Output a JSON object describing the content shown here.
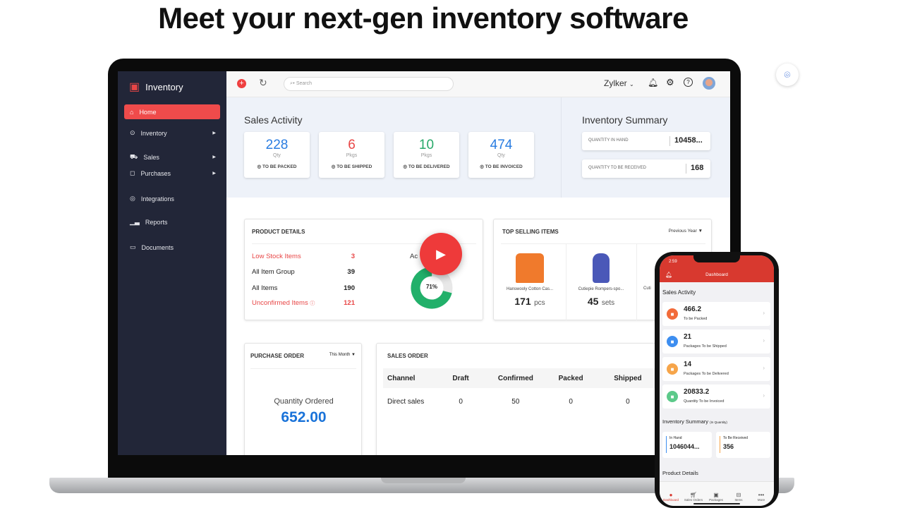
{
  "headline": "Meet your next-gen inventory software",
  "app": {
    "name": "Inventory",
    "sidebar": [
      {
        "label": "Home",
        "icon": "home-icon",
        "active": true
      },
      {
        "label": "Inventory",
        "icon": "inventory-icon",
        "submenu": true
      },
      {
        "label": "Sales",
        "icon": "cart-icon",
        "submenu": true
      },
      {
        "label": "Purchases",
        "icon": "bag-icon",
        "submenu": true
      },
      {
        "label": "Integrations",
        "icon": "integrations-icon"
      },
      {
        "label": "Reports",
        "icon": "reports-icon"
      },
      {
        "label": "Documents",
        "icon": "folder-icon"
      }
    ],
    "topbar": {
      "search_placeholder": "Search",
      "org": "Zylker"
    },
    "sales_activity": {
      "title": "Sales Activity",
      "cards": [
        {
          "value": "228",
          "unit": "Qty",
          "label": "TO BE PACKED",
          "color": "#2a7de1"
        },
        {
          "value": "6",
          "unit": "Pkgs",
          "label": "TO BE SHIPPED",
          "color": "#e84646"
        },
        {
          "value": "10",
          "unit": "Pkgs",
          "label": "TO BE DELIVERED",
          "color": "#28a96a"
        },
        {
          "value": "474",
          "unit": "Qty",
          "label": "TO BE INVOICED",
          "color": "#2a7de1"
        }
      ]
    },
    "inventory_summary": {
      "title": "Inventory Summary",
      "rows": [
        {
          "label": "QUANTITY IN HAND",
          "value": "10458..."
        },
        {
          "label": "QUANTITY TO BE RECEIVED",
          "value": "168"
        }
      ]
    },
    "product_details": {
      "title": "PRODUCT DETAILS",
      "rows": [
        {
          "label": "Low Stock Items",
          "value": "3"
        },
        {
          "label": "All Item Group",
          "value": "39"
        },
        {
          "label": "All Items",
          "value": "190"
        },
        {
          "label": "Unconfirmed Items",
          "value": "121"
        }
      ],
      "chart_label": "Ac",
      "active_percent": "71%",
      "active_fraction": 0.71
    },
    "top_selling": {
      "title": "TOP SELLING ITEMS",
      "period": "Previous Year",
      "items": [
        {
          "name": "Hanswooly Cotton Cas...",
          "qty": "171",
          "unit": "pcs"
        },
        {
          "name": "Cutiepie Rompers-spo...",
          "qty": "45",
          "unit": "sets"
        },
        {
          "name": "Cuti"
        }
      ]
    },
    "purchase_order": {
      "title": "PURCHASE ORDER",
      "period": "This Month",
      "label": "Quantity Ordered",
      "value": "652.00"
    },
    "sales_order": {
      "title": "SALES ORDER",
      "columns": [
        "Channel",
        "Draft",
        "Confirmed",
        "Packed",
        "Shipped"
      ],
      "rows": [
        [
          "Direct sales",
          "0",
          "50",
          "0",
          "0"
        ]
      ]
    }
  },
  "phone": {
    "time": "2:59",
    "title": "Dashboard",
    "sales_activity": "Sales Activity",
    "cards": [
      {
        "value": "466.2",
        "label": "To be Packed",
        "color": "#f26b3a"
      },
      {
        "value": "21",
        "label": "Packages To be Shipped",
        "color": "#3d8ef0"
      },
      {
        "value": "14",
        "label": "Packages To be Delivered",
        "color": "#f6a54a"
      },
      {
        "value": "20833.2",
        "label": "Quantity To be Invoiced",
        "color": "#5cc98a"
      }
    ],
    "inventory_summary": "Inventory Summary",
    "inventory_note": "(In Quantity)",
    "in_hand_label": "In Hand",
    "in_hand": "1046044...",
    "to_receive_label": "To Be Received",
    "to_receive": "356",
    "product_details": "Product Details",
    "tabs": [
      "Dashboard",
      "Sales Orders",
      "Packages",
      "Items",
      "More"
    ]
  }
}
